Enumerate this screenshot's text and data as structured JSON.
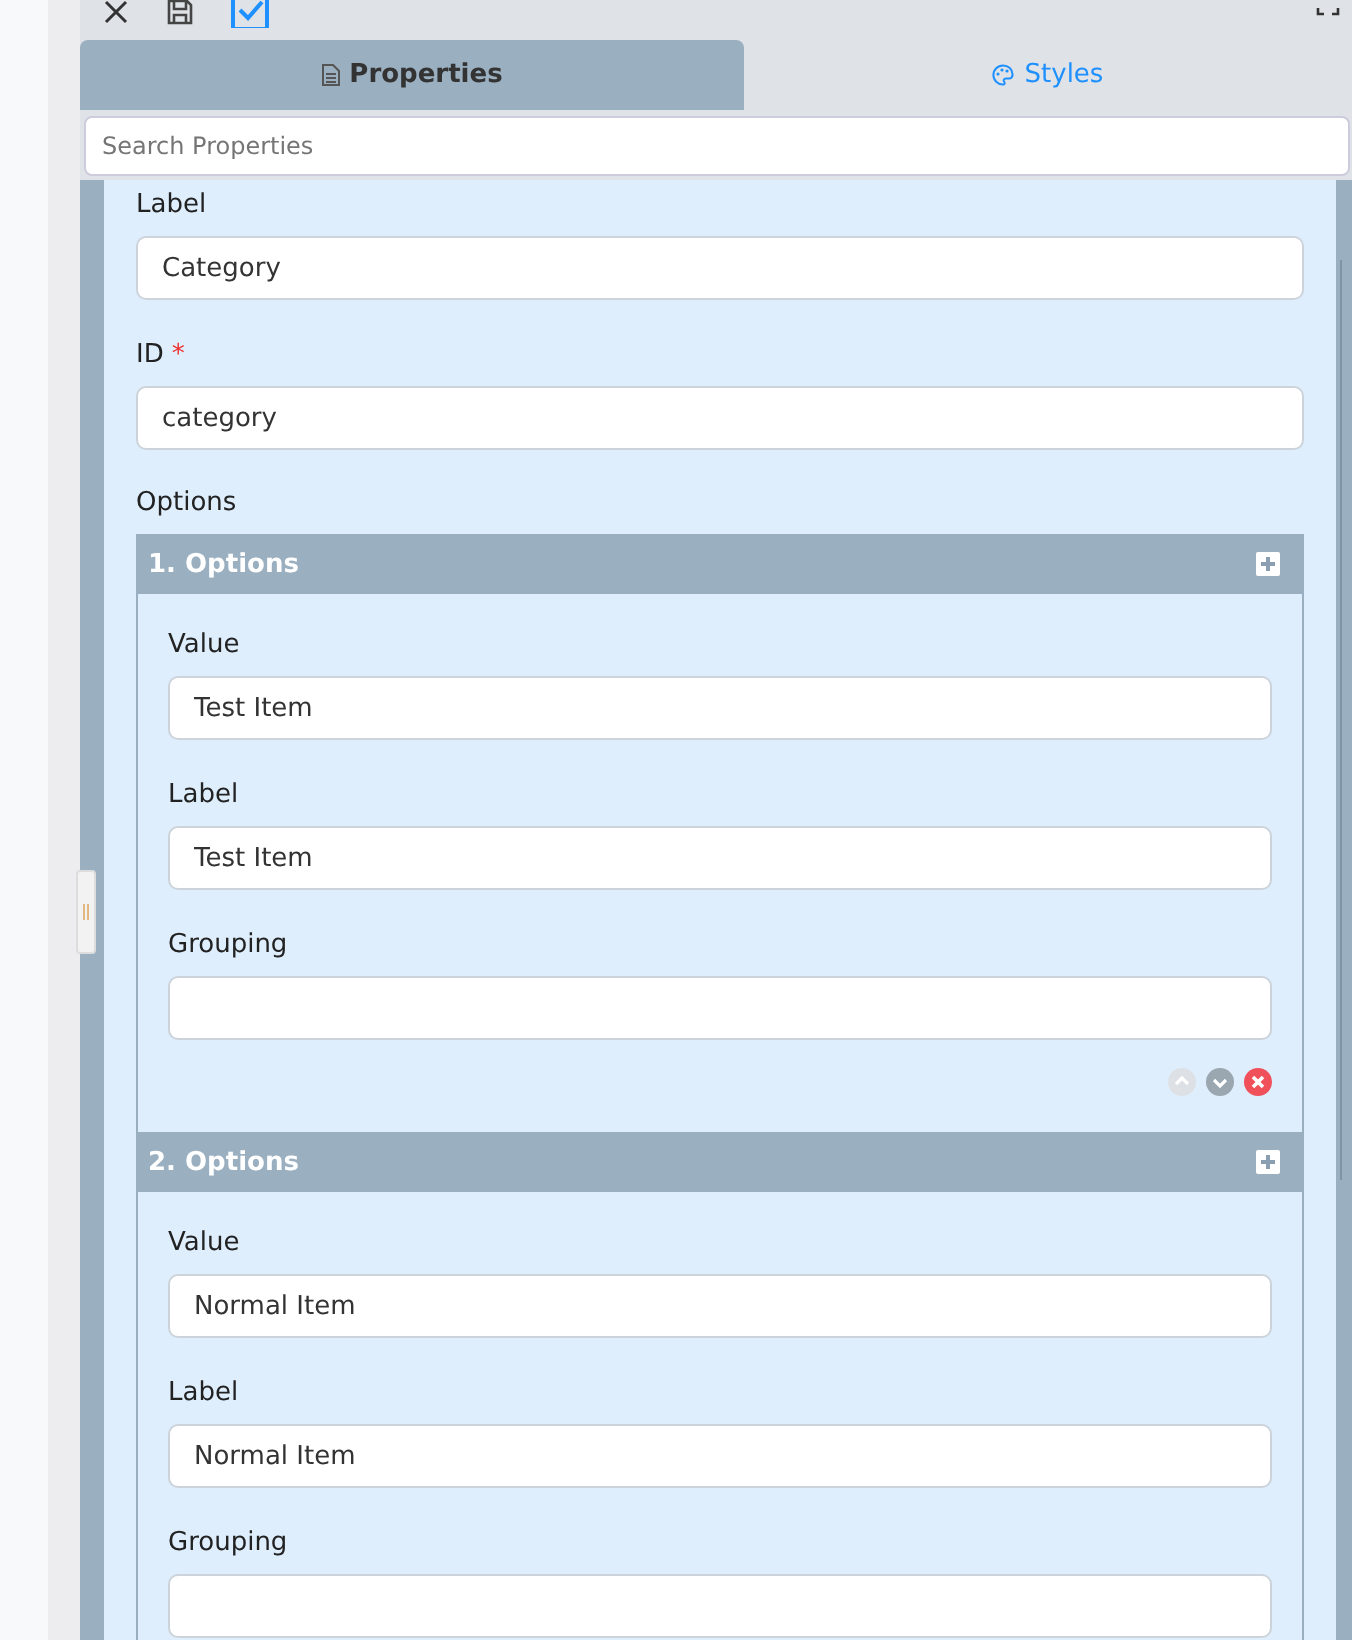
{
  "toolbar": {
    "tools": [
      {
        "kind": "close"
      },
      {
        "kind": "save"
      },
      {
        "kind": "check",
        "selected": true
      }
    ]
  },
  "tabs": [
    {
      "label": "Properties",
      "kind": "properties",
      "selected": true
    },
    {
      "label": "Styles",
      "kind": "styles",
      "selected": false
    }
  ],
  "search": {
    "placeholder": "Search Properties"
  },
  "fields": [
    {
      "label": "Label",
      "value": "Category"
    },
    {
      "label": "ID",
      "value": "category",
      "required_mark": "*"
    }
  ],
  "options": {
    "label": "Options",
    "items": [
      {
        "title": "1. Options",
        "fields": [
          {
            "label": "Value",
            "value": "Test Item"
          },
          {
            "label": "Label",
            "value": "Test Item"
          },
          {
            "label": "Grouping"
          }
        ],
        "actions": [
          {
            "kind": "up",
            "disabled": true
          },
          {
            "kind": "down",
            "disabled": false
          },
          {
            "kind": "remove",
            "disabled": false
          }
        ]
      },
      {
        "title": "2. Options",
        "fields": [
          {
            "label": "Value",
            "value": "Normal Item"
          },
          {
            "label": "Label",
            "value": "Normal Item"
          },
          {
            "label": "Grouping"
          }
        ]
      }
    ]
  }
}
